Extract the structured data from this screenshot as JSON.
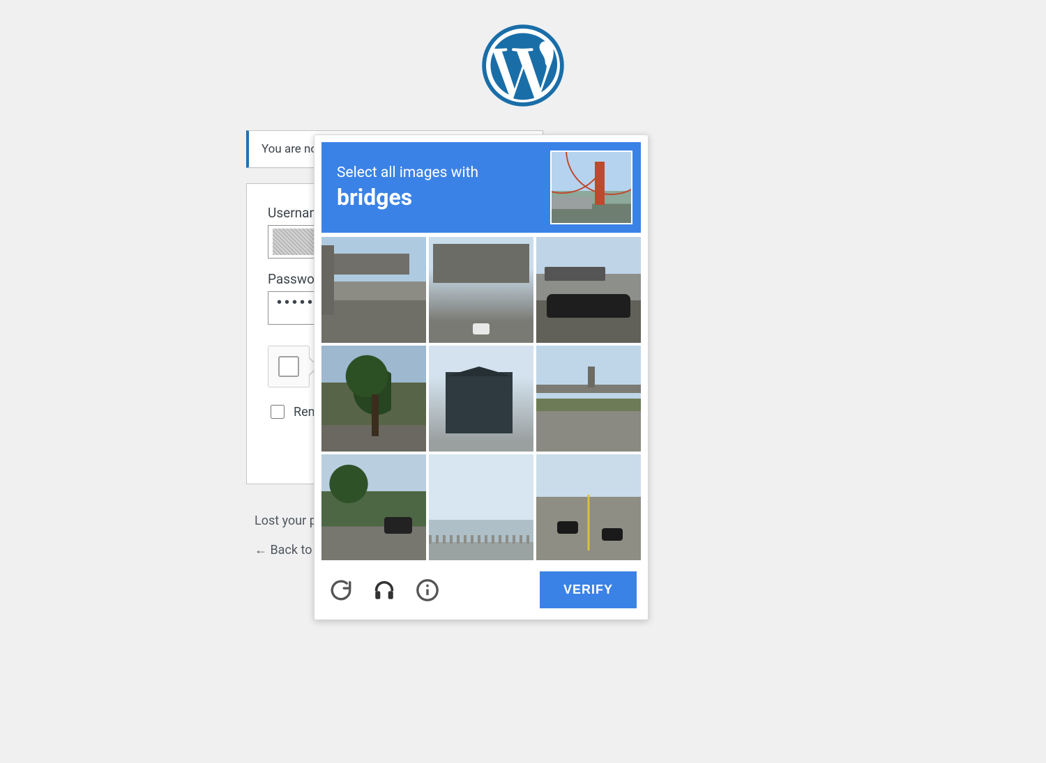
{
  "notice": {
    "text": "You are now logged out."
  },
  "login": {
    "username_label": "Username or Email Address",
    "password_label": "Password",
    "password_value": "••••••",
    "remember_label": "Remember Me"
  },
  "links": {
    "lost": "Lost your password?",
    "back": "← Back to"
  },
  "captcha": {
    "prompt_line1": "Select all images with",
    "prompt_keyword": "bridges",
    "verify_label": "VERIFY",
    "icons": {
      "reload": "reload-icon",
      "audio": "headphones-icon",
      "info": "info-icon"
    },
    "tiles": [
      "overpass-bridge",
      "highway-underpass",
      "car-bus-stop",
      "tree-street",
      "house",
      "road-overpass",
      "park-trees",
      "waterfront-railing",
      "intersection-road"
    ]
  }
}
